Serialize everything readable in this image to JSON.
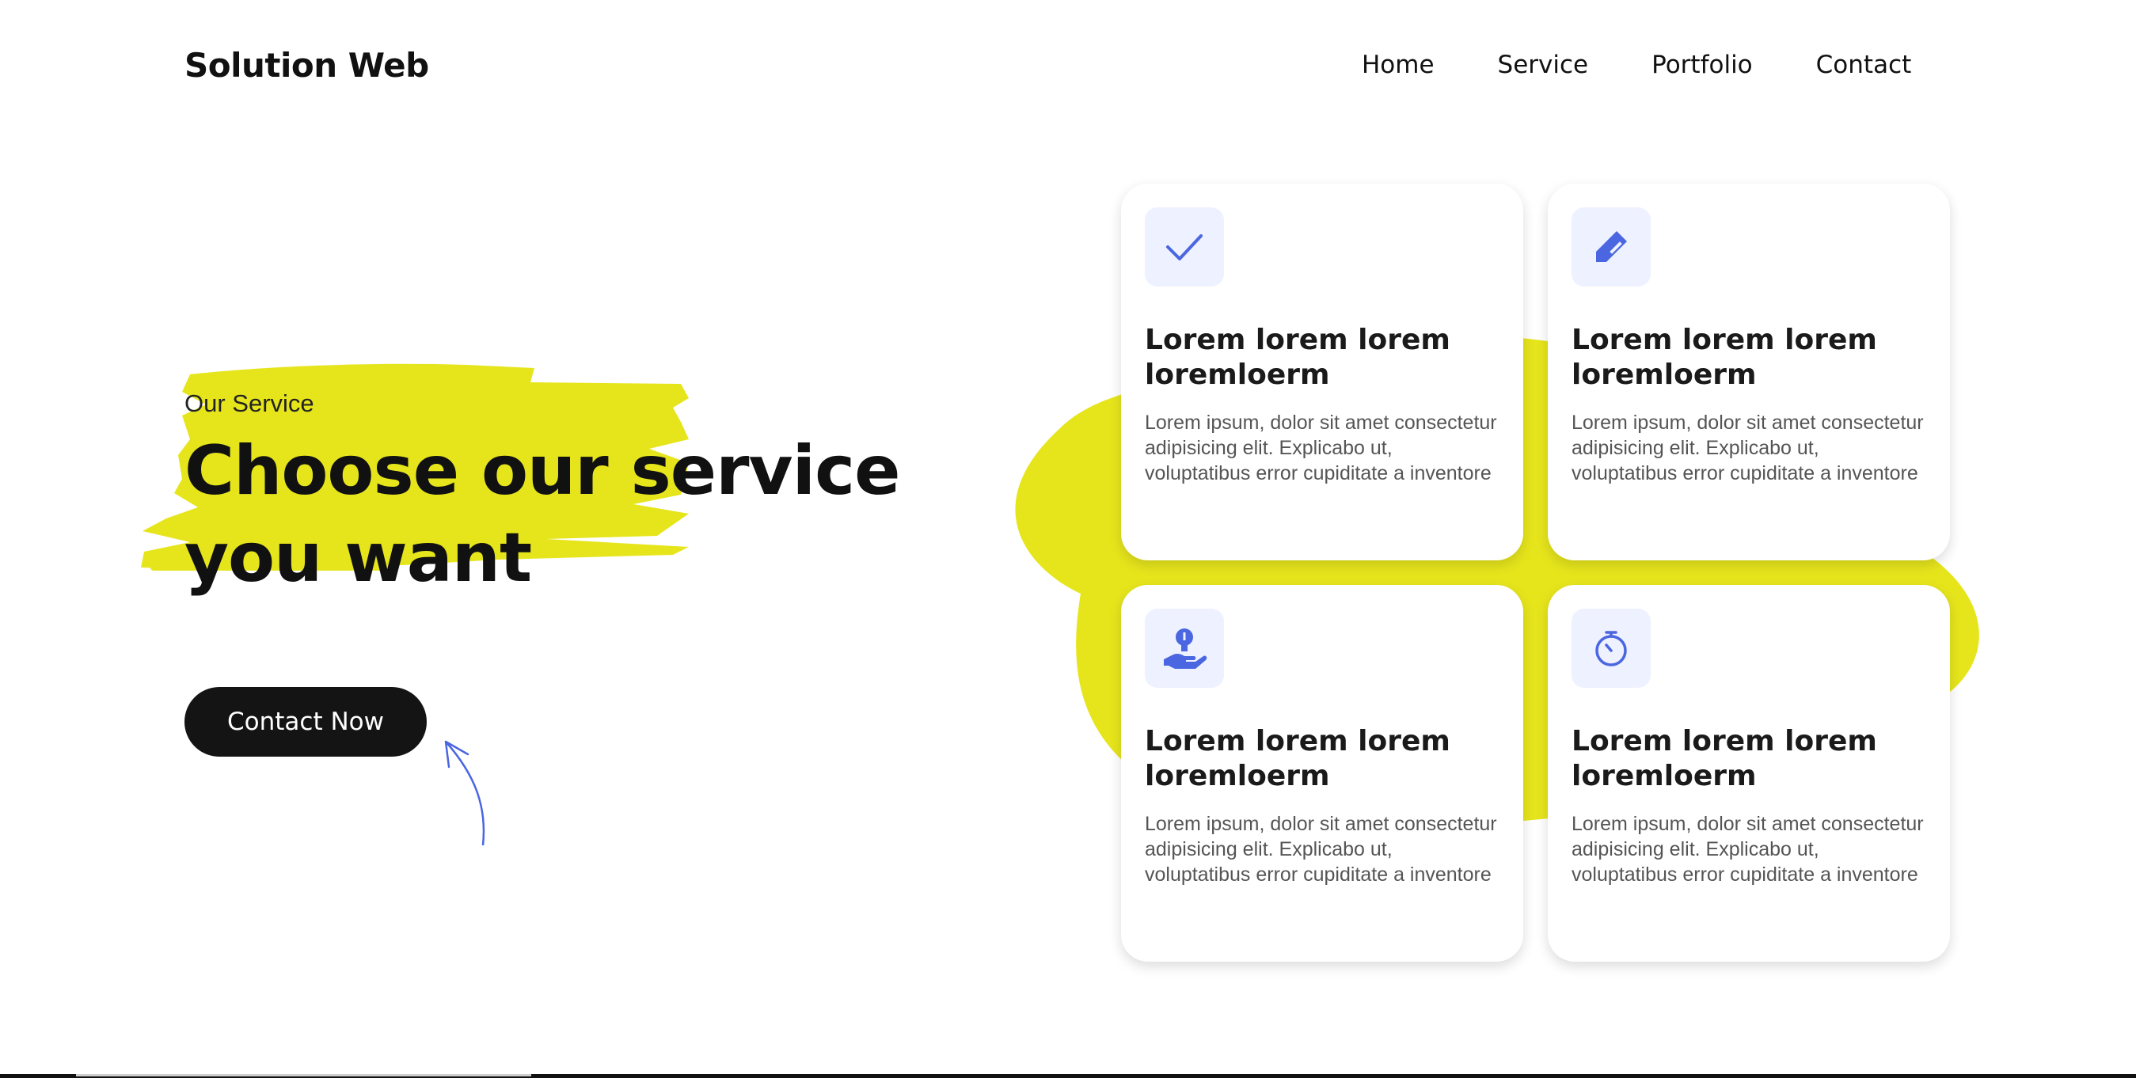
{
  "brand": "Solution Web",
  "nav": {
    "items": [
      "Home",
      "Service",
      "Portfolio",
      "Contact"
    ]
  },
  "hero": {
    "eyebrow": "Our Service",
    "headline_line1": "Choose our service",
    "headline_line2": "you want",
    "cta_label": "Contact Now"
  },
  "cards": [
    {
      "icon": "checkmark-icon",
      "title_line1": "Lorem lorem lorem",
      "title_line2": "loremloerm",
      "text": "Lorem ipsum, dolor sit amet consectetur adipisicing elit. Explicabo ut, voluptatibus error cupiditate a inventore"
    },
    {
      "icon": "pencil-icon",
      "title_line1": "Lorem lorem lorem",
      "title_line2": "loremloerm",
      "text": "Lorem ipsum, dolor sit amet consectetur adipisicing elit. Explicabo ut, voluptatibus error cupiditate a inventore"
    },
    {
      "icon": "idea-hand-icon",
      "title_line1": "Lorem lorem lorem",
      "title_line2": "loremloerm",
      "text": "Lorem ipsum, dolor sit amet consectetur adipisicing elit. Explicabo ut, voluptatibus error cupiditate a inventore"
    },
    {
      "icon": "stopwatch-icon",
      "title_line1": "Lorem lorem lorem",
      "title_line2": "loremloerm",
      "text": "Lorem ipsum, dolor sit amet consectetur adipisicing elit. Explicabo ut, voluptatibus error cupiditate a inventore"
    }
  ],
  "colors": {
    "accent_yellow": "#e6e51c",
    "icon_blue": "#4a66e0",
    "icon_bg": "#eef1ff",
    "button_dark": "#141414"
  }
}
